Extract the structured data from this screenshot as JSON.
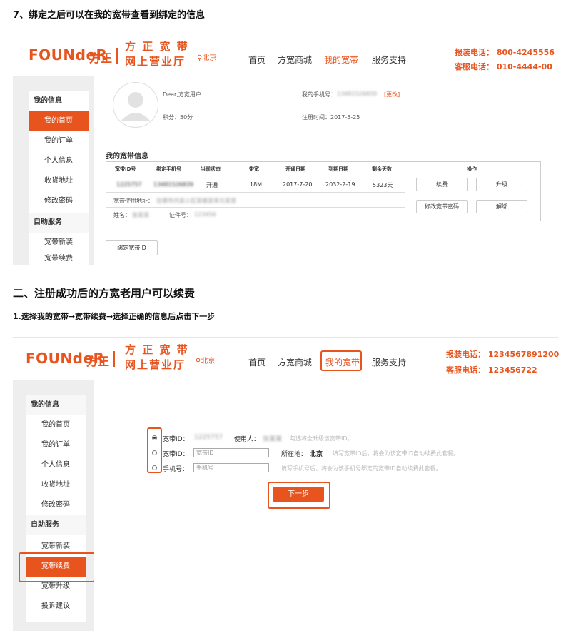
{
  "headings": {
    "h1": "7、绑定之后可以在我的宽带查看到绑定的信息",
    "h2": "二、注册成功后的方宽老用户可以续费",
    "h3": "1.选择我的宽带→宽带续费→选择正确的信息后点击下一步"
  },
  "header1": {
    "logo_en": "FOUNdeR",
    "logo_cn": "方正",
    "slogan_line1": "方 正 宽 带",
    "slogan_line2": "网上营业厅",
    "location": "北京",
    "nav": [
      "首页",
      "方宽商城",
      "我的宽带",
      "服务支持"
    ],
    "install_hotline": "报装电话： 800-4245556",
    "service_hotline": "客服电话： 010-4444-00"
  },
  "header2": {
    "logo_en": "FOUNdeR",
    "logo_cn": "方正",
    "slogan_line1": "方 正 宽 带",
    "slogan_line2": "网上营业厅",
    "location": "北京",
    "nav": [
      "首页",
      "方宽商城",
      "我的宽带",
      "服务支持"
    ],
    "install_hotline": "报装电话： 1234567891200",
    "service_hotline": "客服电话： 123456722"
  },
  "sidebar1": {
    "my_info": "我的信息",
    "items": [
      "我的首页",
      "我的订单",
      "个人信息",
      "收货地址",
      "修改密码"
    ],
    "self_service": "自助服务",
    "service_items": [
      "宽带新装",
      "宽带续费"
    ]
  },
  "sidebar2": {
    "my_info": "我的信息",
    "items": [
      "我的首页",
      "我的订单",
      "个人信息",
      "收货地址",
      "修改密码"
    ],
    "self_service": "自助服务",
    "service_items": [
      "宽带新装",
      "宽带续费",
      "宽带升级",
      "投诉建议"
    ]
  },
  "profile": {
    "greeting": "Dear,方宽用户",
    "points": "积分：50分",
    "phone_label": "我的手机号：",
    "phone_value": "13481526839",
    "change_link": "[更改]",
    "register_time": "注册时间：2017-5-25"
  },
  "broadband": {
    "title": "我的宽带信息",
    "columns": [
      "宽带ID号",
      "绑定手机号",
      "当前状态",
      "带宽",
      "开通日期",
      "到期日期",
      "剩余天数"
    ],
    "row": [
      "1225757",
      "13481526839",
      "开通",
      "18M",
      "2017-7-20",
      "2032-2-19",
      "5323天"
    ],
    "ops_label": "操作",
    "address_label": "宽带使用地址：",
    "address_value": "在哪市内某小区某楼某单元某室",
    "name_label": "姓名：",
    "name_value": "张某某",
    "id_label": "证件号：",
    "id_value": "123456",
    "buttons": [
      "续费",
      "升级",
      "修改宽带密码",
      "解绑"
    ],
    "bind_button": "绑定宽带ID"
  },
  "renew_form": {
    "row1_label": "宽带ID：",
    "row1_value": "1225757",
    "row1_user_label": "使用人：",
    "row1_user_value": "张某某",
    "row1_hint": "勾选将全升级该宽带ID。",
    "row2_label": "宽带ID：",
    "row2_placeholder": "宽带ID",
    "row2_location_label": "所在地：",
    "row2_location_value": "北京",
    "row2_hint": "填写宽带ID后，将会为该宽带ID自动续费此套餐。",
    "row3_label": "手机号：",
    "row3_placeholder": "手机号",
    "row3_hint": "填写手机号后，将会为该手机号绑定的宽带ID自动续费此套餐。",
    "next_button": "下一步"
  },
  "colors": {
    "accent": "#e8541e",
    "page_bg": "#eeeeee"
  }
}
